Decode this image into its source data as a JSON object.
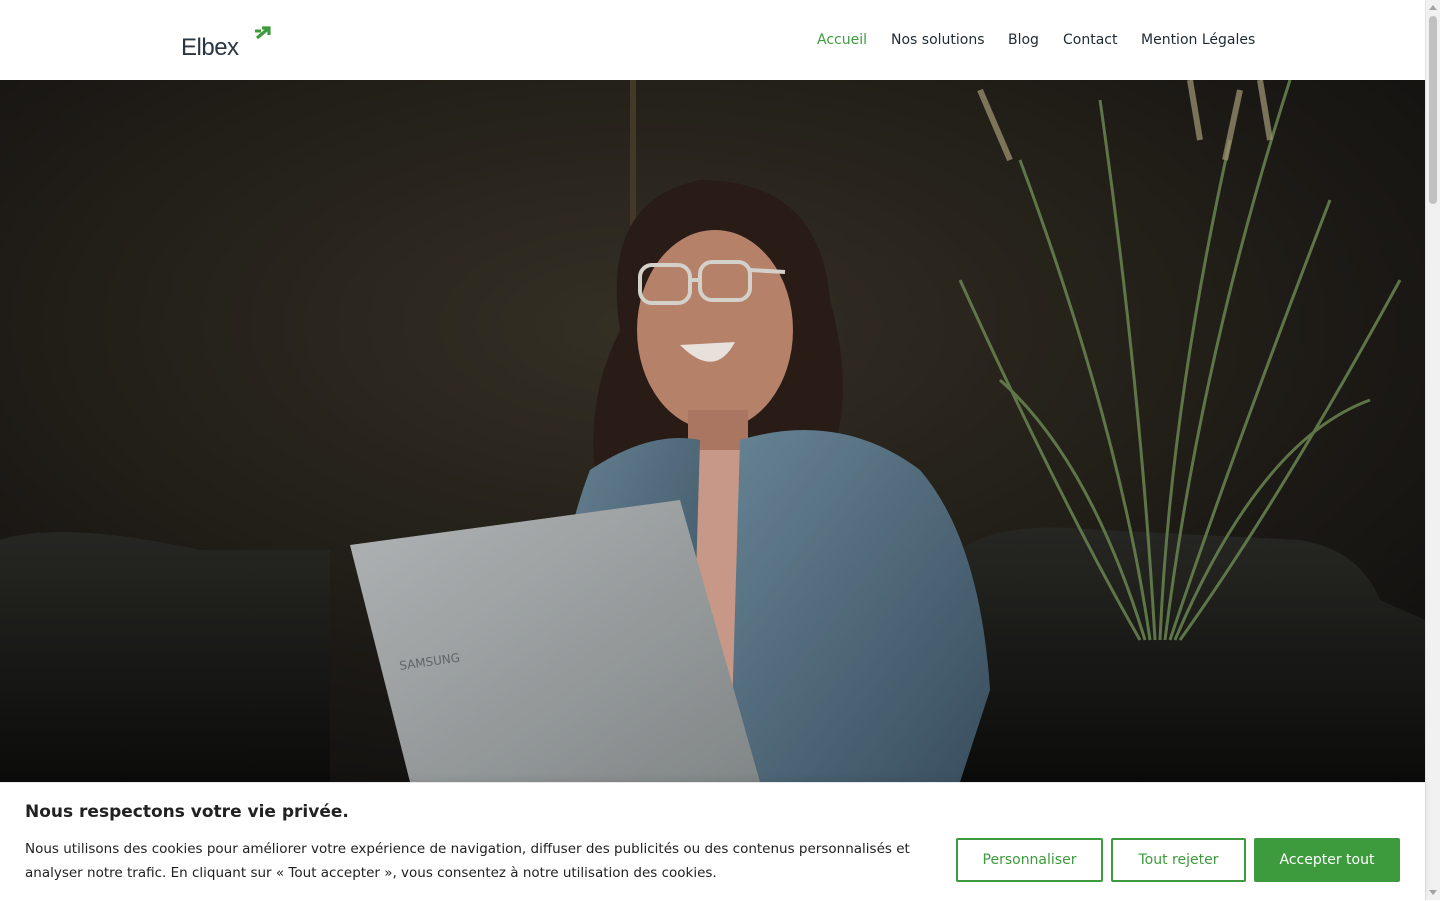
{
  "brand": {
    "name": "Elbex",
    "accent_color": "#3d9a3d",
    "text_color": "#2b3640"
  },
  "nav": {
    "items": [
      {
        "label": "Accueil",
        "active": true
      },
      {
        "label": "Nos solutions",
        "active": false
      },
      {
        "label": "Blog",
        "active": false
      },
      {
        "label": "Contact",
        "active": false
      },
      {
        "label": "Mention Légales",
        "active": false
      }
    ]
  },
  "hero": {
    "image_subject": "smiling woman in denim jacket using a laptop in front of plants"
  },
  "cookie_banner": {
    "title": "Nous respectons votre vie privée.",
    "text": "Nous utilisons des cookies pour améliorer votre expérience de navigation, diffuser des publicités ou des contenus personnalisés et analyser notre trafic. En cliquant sur « Tout accepter », vous consentez à notre utilisation des cookies.",
    "buttons": {
      "customize": "Personnaliser",
      "reject": "Tout rejeter",
      "accept": "Accepter tout"
    }
  }
}
